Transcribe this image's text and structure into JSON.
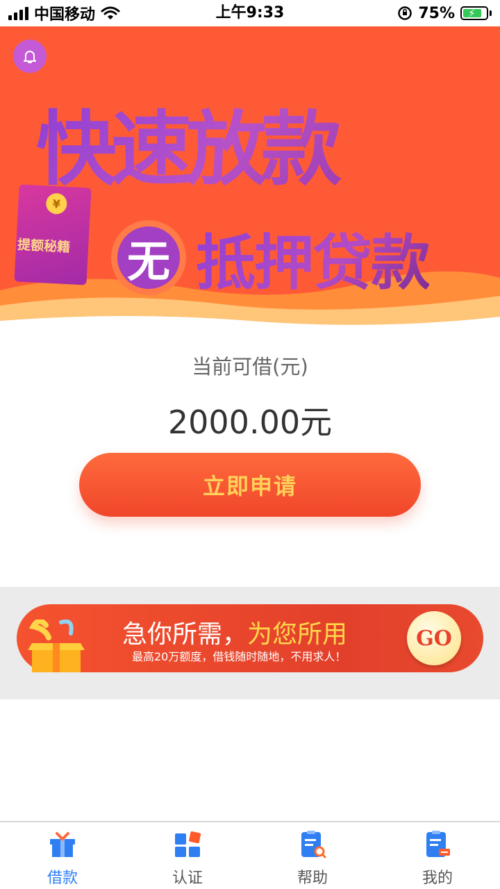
{
  "status_bar": {
    "carrier": "中国移动",
    "time": "上午9:33",
    "battery_percent": "75%"
  },
  "banner": {
    "headline": "快速放款",
    "badge": "无",
    "subline": "抵押贷款",
    "envelope_label": "提额秘籍",
    "coin_symbol": "¥"
  },
  "loan": {
    "title": "当前可借(元)",
    "amount": "2000.00元",
    "apply_label": "立即申请"
  },
  "promo": {
    "title_part1": "急你所需，",
    "title_part2": "为您所用",
    "subtitle": "最高20万额度，借钱随时随地，不用求人！",
    "go_label": "GO"
  },
  "tabs": [
    {
      "label": "借款",
      "icon": "gift-icon",
      "active": true
    },
    {
      "label": "认证",
      "icon": "blocks-icon",
      "active": false
    },
    {
      "label": "帮助",
      "icon": "help-doc-icon",
      "active": false
    },
    {
      "label": "我的",
      "icon": "profile-doc-icon",
      "active": false
    }
  ],
  "colors": {
    "brand_orange": "#ff5a36",
    "tab_active": "#2f7ff2",
    "button_text": "#ffd25a"
  }
}
